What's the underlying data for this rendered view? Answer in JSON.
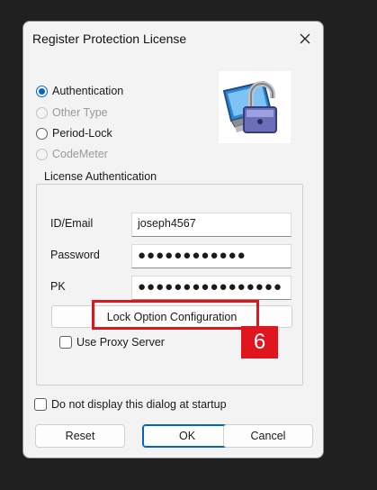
{
  "dialog": {
    "title": "Register Protection License",
    "close_icon": "close-icon"
  },
  "license_type": {
    "options": [
      {
        "label": "Authentication",
        "checked": true,
        "enabled": true
      },
      {
        "label": "Other Type",
        "checked": false,
        "enabled": false
      },
      {
        "label": "Period-Lock",
        "checked": false,
        "enabled": true
      },
      {
        "label": "CodeMeter",
        "checked": false,
        "enabled": false
      }
    ]
  },
  "logo_icon": "computer-padlock-icon",
  "auth_group": {
    "legend": "License Authentication",
    "id_label": "ID/Email",
    "id_value": "joseph4567",
    "password_label": "Password",
    "password_value": "●●●●●●●●●●●●",
    "pk_label": "PK",
    "pk_value": "●●●●●●●●●●●●●●●●",
    "lock_option_button": "Lock Option Configuration",
    "proxy_label": "Use Proxy Server",
    "proxy_checked": false
  },
  "startup_checkbox": {
    "label": "Do not display this dialog at startup",
    "checked": false
  },
  "buttons": {
    "reset": "Reset",
    "ok": "OK",
    "cancel": "Cancel"
  },
  "annotation": {
    "step_number": "6",
    "color": "#e0161e"
  }
}
